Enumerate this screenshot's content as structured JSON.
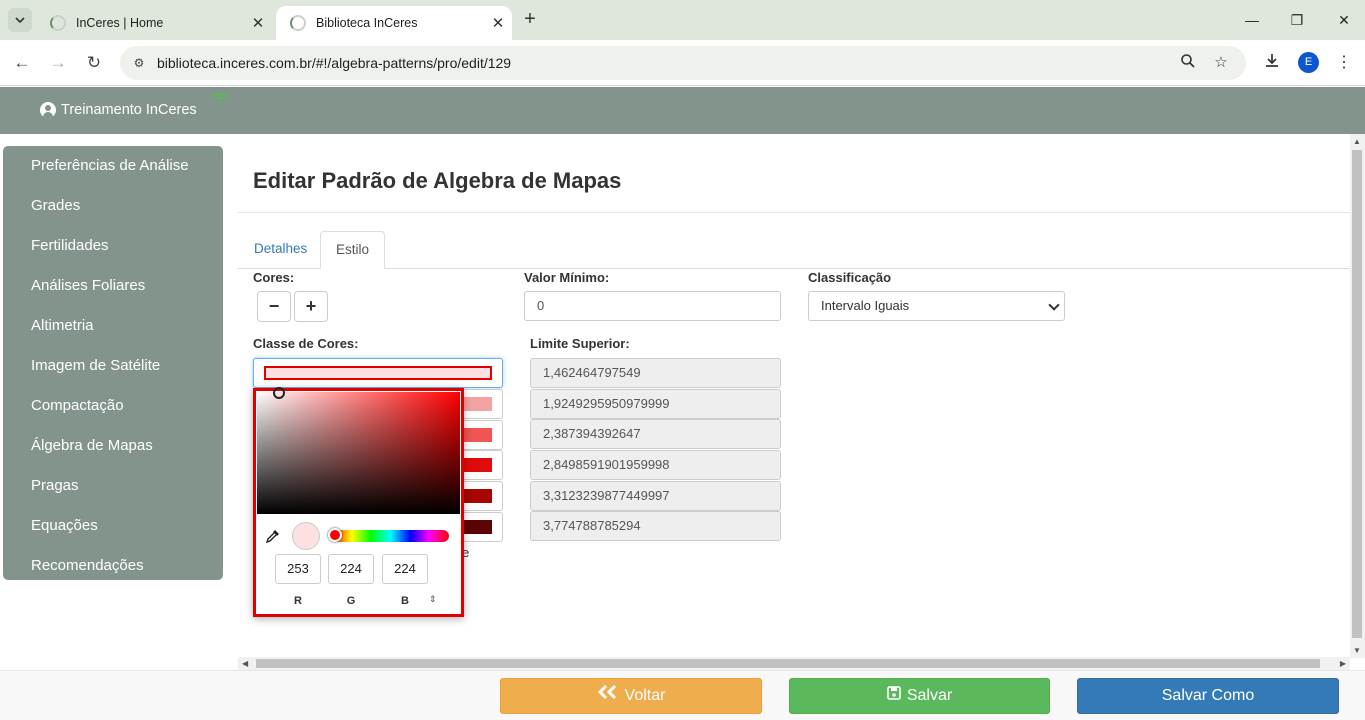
{
  "browser": {
    "tabs": [
      {
        "title": "InCeres | Home",
        "active": false
      },
      {
        "title": "Biblioteca InCeres",
        "active": true
      }
    ],
    "url": "biblioteca.inceres.com.br/#!/algebra-patterns/pro/edit/129",
    "profile_initial": "E"
  },
  "header": {
    "user_name": "Treinamento InCeres"
  },
  "sidebar": {
    "items": [
      {
        "label": "Preferências de Análise"
      },
      {
        "label": "Grades"
      },
      {
        "label": "Fertilidades"
      },
      {
        "label": "Análises Foliares"
      },
      {
        "label": "Altimetria"
      },
      {
        "label": "Imagem de Satélite"
      },
      {
        "label": "Compactação"
      },
      {
        "label": "Álgebra de Mapas"
      },
      {
        "label": "Pragas"
      },
      {
        "label": "Equações"
      },
      {
        "label": "Recomendações"
      }
    ]
  },
  "main": {
    "title": "Editar Padrão de Algebra de Mapas",
    "tabs": [
      {
        "label": "Detalhes",
        "active": false
      },
      {
        "label": "Estilo",
        "active": true
      }
    ],
    "cores_label": "Cores:",
    "minus": "−",
    "plus": "+",
    "valor_minimo_label": "Valor Mínimo:",
    "valor_minimo_value": "0",
    "classificacao_label": "Classificação",
    "classificacao_value": "Intervalo Iguais",
    "classe_cores_label": "Classe de Cores:",
    "limite_superior_label": "Limite Superior:",
    "color_classes": [
      {
        "color": "#fde0e0",
        "limit": "1,462464797549"
      },
      {
        "color": "#f4a3a3",
        "limit": "1,9249295950979999"
      },
      {
        "color": "#f05454",
        "limit": "2,387394392647"
      },
      {
        "color": "#e00b0b",
        "limit": "2,8498591901959998"
      },
      {
        "color": "#a80505",
        "limit": "3,3123239877449997"
      },
      {
        "color": "#5e0303",
        "limit": "3,774788785294"
      }
    ],
    "hidden_text_fragment": "e"
  },
  "color_picker": {
    "r": "253",
    "g": "224",
    "b": "224",
    "r_label": "R",
    "g_label": "G",
    "b_label": "B",
    "preview_color": "#fde0e0",
    "mode_toggle_icon": "⇕"
  },
  "footer": {
    "back_label": "Voltar",
    "save_label": "Salvar",
    "save_as_label": "Salvar Como"
  },
  "colors": {
    "header_bg": "#83948d",
    "sidebar_bg": "#83948d",
    "back_btn": "#f0ad4e",
    "save_btn": "#5cb85c",
    "save_as_btn": "#337ab7",
    "picker_border": "#e00000"
  }
}
